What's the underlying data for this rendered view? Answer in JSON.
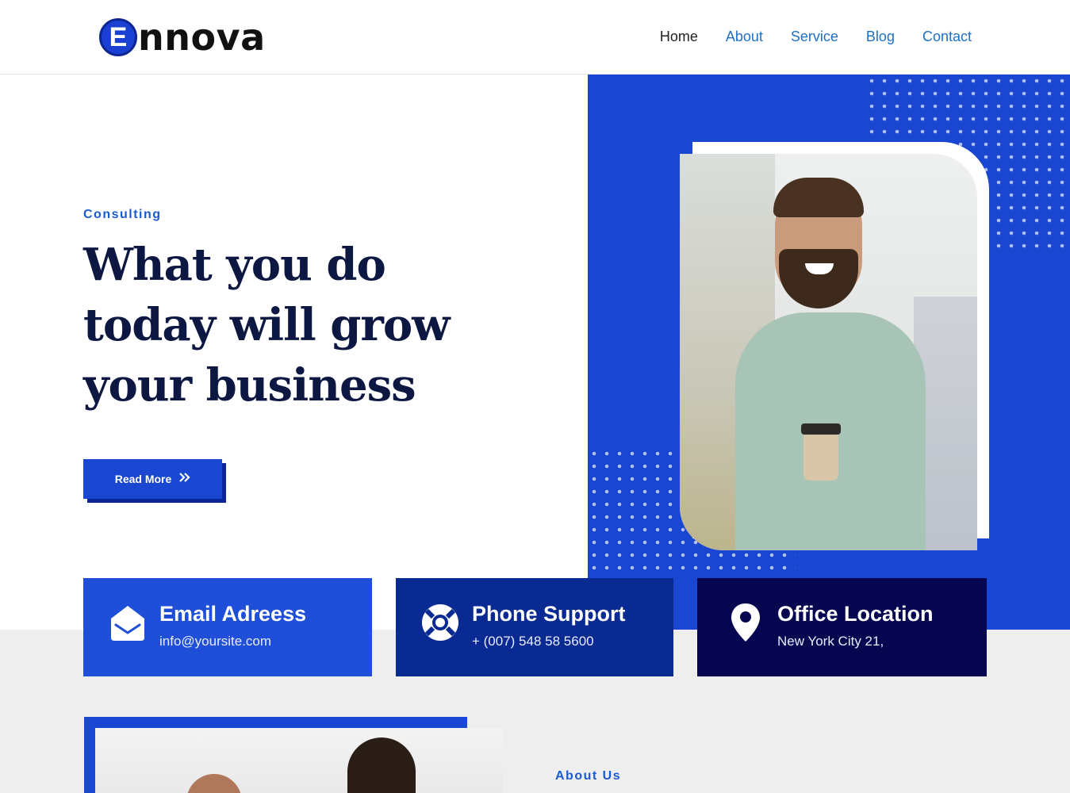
{
  "brand": {
    "logo_letter": "E",
    "logo_text": "nnova",
    "accent": "#1a47d1",
    "dark": "#0c1742"
  },
  "nav": {
    "items": [
      "Home",
      "About",
      "Service",
      "Blog",
      "Contact"
    ],
    "active": "Home"
  },
  "hero": {
    "eyebrow": "Consulting",
    "headline": "What you do today will grow your business",
    "button_label": "Read More",
    "button_icon": "double-chevron-right-icon"
  },
  "contact_cards": [
    {
      "title": "Email Adreess",
      "value": "info@yoursite.com",
      "icon": "envelope-open-icon",
      "color": "#1f4fd8"
    },
    {
      "title": "Phone Support",
      "value": "+ (007) 548 58 5600",
      "icon": "lifebuoy-icon",
      "color": "#0a2a93"
    },
    {
      "title": "Office Location",
      "value": "New York City 21,",
      "icon": "map-pin-icon",
      "color": "#050550"
    }
  ],
  "about": {
    "eyebrow": "About Us"
  }
}
